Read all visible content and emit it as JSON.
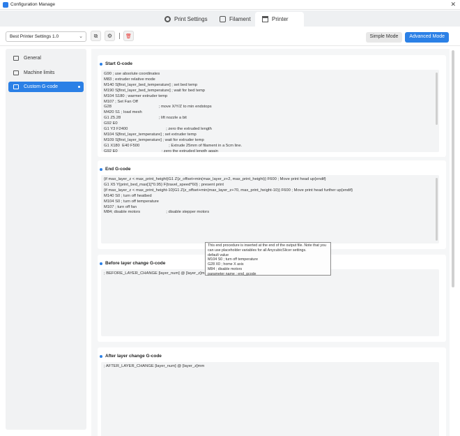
{
  "window": {
    "title": "Configuration Manage",
    "close_glyph": "✕"
  },
  "tabs": [
    {
      "label": "Print Settings",
      "icon": "gear-icon"
    },
    {
      "label": "Filament",
      "icon": "filament-icon"
    },
    {
      "label": "Printer",
      "icon": "printer-icon",
      "active": true
    }
  ],
  "toolbar": {
    "preset": "Best Printer Settings 1.0",
    "copy_glyph": "⧉",
    "settings_glyph": "⚙",
    "delete_glyph": "🗑",
    "mode_simple": "Simple Mode",
    "mode_advanced": "Advanced Mode"
  },
  "sidebar": {
    "items": [
      {
        "label": "General",
        "icon": "printer-icon"
      },
      {
        "label": "Machine limits",
        "icon": "limits-icon"
      },
      {
        "label": "Custom G-code",
        "icon": "code-icon",
        "active": true
      }
    ]
  },
  "sections": {
    "start": {
      "title": "Start G-code",
      "lines": [
        "G90 ; use absolute coordinates",
        "M83 ; extruder relative mode",
        "M140 S[first_layer_bed_temperature] ; set bed temp",
        "M190 S[first_layer_bed_temperature] ; wait for bed temp",
        "M104 S180 ; warmer extruder temp",
        "M107 ; Set Fan Off",
        "G28                                          ; move X/Y/Z to min endstops",
        "M420 S1 ; load mesh",
        "G1 Z5.28                                  ; lift nozzle a bit",
        "G92 E0",
        "G1 Y3 F2400                                  ; zero the extruded length",
        "M104 S[first_layer_temperature] ; set extruder temp",
        "M109 S[first_layer_temperature] ; wait for extruder temp",
        "G1 X180  E40 F500                          ; Extrude 25mm of filament in a 5cm line.",
        "G92 E0                                       ; zero the extruded length again"
      ]
    },
    "end": {
      "title": "End G-code",
      "lines": [
        "{if max_layer_z < max_print_height}G1 Z{z_offset+min(max_layer_z+2, max_print_height)} F600 ; Move print head up{endif}",
        "G1 X5 Y{print_bed_max[1]*0.95} F{travel_speed*60} ; present print",
        "{if max_layer_z < max_print_height-10}G1 Z{z_offset+min(max_layer_z+70, max_print_height-10)} F600 ; Move print head further up{endif}",
        "M140 S0 ; turn off heatbed",
        "M104 S0 ; turn off temperature",
        "M107 ; turn off fan",
        "M84; disable motors                       ; disable stepper motors"
      ]
    },
    "before_layer": {
      "title": "Before layer change G-code",
      "lines": [
        "; BEFORE_LAYER_CHANGE [layer_num] @ [layer_z]mm"
      ]
    },
    "after_layer": {
      "title": "After layer change G-code",
      "lines": [
        "; AFTER_LAYER_CHANGE [layer_num] @ [layer_z]mm"
      ]
    }
  },
  "tooltip": {
    "lines": [
      "This end procedure is inserted at the end of the output file. Note that you",
      "can use placeholder variables for all AnycubicSlicer settings.",
      "default value",
      "M104 S0 ; turn off temperature",
      "G28 X0  ; home X axis",
      "M84     ; disable motors",
      "parameter name    : end_gcode"
    ]
  },
  "colors": {
    "accent": "#2b80e6",
    "panel": "#f1f2f3",
    "delete": "#e53935"
  }
}
